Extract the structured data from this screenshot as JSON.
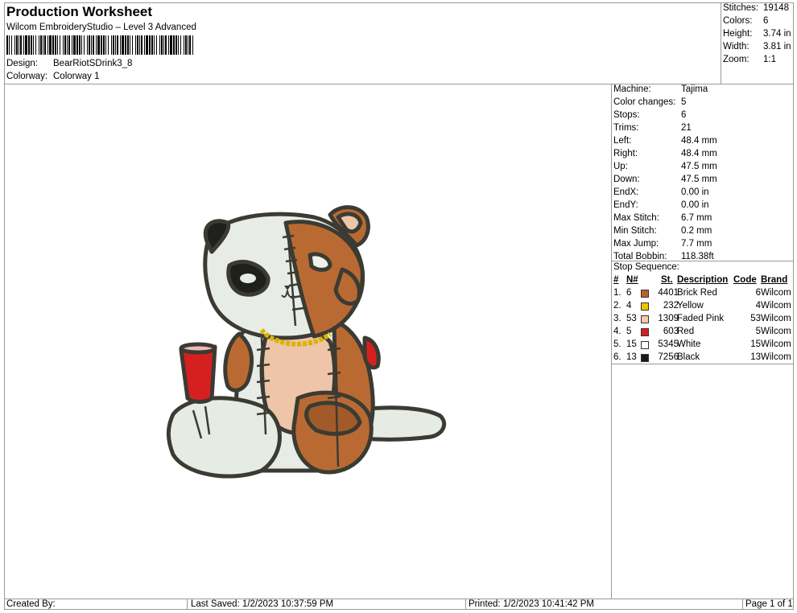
{
  "header": {
    "title": "Production Worksheet",
    "subtitle": "Wilcom EmbroideryStudio – Level 3 Advanced",
    "design_label": "Design:",
    "design_value": "BearRiotSDrink3_8",
    "colorway_label": "Colorway:",
    "colorway_value": "Colorway 1"
  },
  "stats": [
    {
      "key": "Stitches:",
      "value": "19148"
    },
    {
      "key": "Colors:",
      "value": "6"
    },
    {
      "key": "Height:",
      "value": "3.74 in"
    },
    {
      "key": "Width:",
      "value": "3.81 in"
    },
    {
      "key": "Zoom:",
      "value": "1:1"
    }
  ],
  "machine_info": [
    {
      "key": "Machine:",
      "value": "Tajima"
    },
    {
      "key": "Color changes:",
      "value": "5"
    },
    {
      "key": "Stops:",
      "value": "6"
    },
    {
      "key": "Trims:",
      "value": "21"
    },
    {
      "key": "Left:",
      "value": "48.4 mm"
    },
    {
      "key": "Right:",
      "value": "48.4 mm"
    },
    {
      "key": "Up:",
      "value": "47.5 mm"
    },
    {
      "key": "Down:",
      "value": "47.5 mm"
    },
    {
      "key": "EndX:",
      "value": "0.00 in"
    },
    {
      "key": "EndY:",
      "value": "0.00 in"
    },
    {
      "key": "Max Stitch:",
      "value": "6.7 mm"
    },
    {
      "key": "Min Stitch:",
      "value": "0.2 mm"
    },
    {
      "key": "Max Jump:",
      "value": "7.7 mm"
    },
    {
      "key": "Total Bobbin:",
      "value": "118.38ft"
    }
  ],
  "stop_sequence": {
    "title": "Stop Sequence:",
    "headers": {
      "num": "#",
      "n": "N#",
      "st": "St.",
      "desc": "Description",
      "code": "Code",
      "brand": "Brand"
    },
    "rows": [
      {
        "num": "1.",
        "n": "6",
        "color": "#c0602a",
        "st": "4401",
        "desc": "Brick Red",
        "code": "6",
        "brand": "Wilcom"
      },
      {
        "num": "2.",
        "n": "4",
        "color": "#f2c200",
        "st": "232",
        "desc": "Yellow",
        "code": "4",
        "brand": "Wilcom"
      },
      {
        "num": "3.",
        "n": "53",
        "color": "#f6c9ae",
        "st": "1309",
        "desc": "Faded Pink",
        "code": "53",
        "brand": "Wilcom"
      },
      {
        "num": "4.",
        "n": "5",
        "color": "#d81e1e",
        "st": "603",
        "desc": "Red",
        "code": "5",
        "brand": "Wilcom"
      },
      {
        "num": "5.",
        "n": "15",
        "color": "#ffffff",
        "st": "5345",
        "desc": "White",
        "code": "15",
        "brand": "Wilcom"
      },
      {
        "num": "6.",
        "n": "13",
        "color": "#1a1a1a",
        "st": "7256",
        "desc": "Black",
        "code": "13",
        "brand": "Wilcom"
      }
    ]
  },
  "footer": {
    "created_by": "Created By:",
    "last_saved": "Last Saved: 1/2/2023 10:37:59 PM",
    "printed": "Printed: 1/2/2023 10:41:42 PM",
    "page": "Page 1 of 1"
  }
}
